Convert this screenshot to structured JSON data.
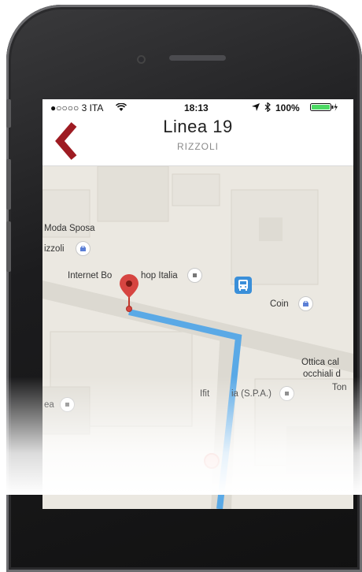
{
  "status_bar": {
    "carrier": "●○○○○ 3 ITA",
    "time": "18:13",
    "battery": "100%"
  },
  "nav": {
    "title": "Linea 19",
    "subtitle": "RIZZOLI"
  },
  "map": {
    "labels": {
      "moda_sposa": "Moda Sposa",
      "rizzoli": "izzoli",
      "internet_shop": "Internet Bo",
      "internet_shop_tail": "hop Italia",
      "coin": "Coin",
      "ottica_line1": "Ottica cal",
      "ottica_line2": "occhiali d",
      "ottica_line3": "Ton",
      "ifitalia": "Ifit",
      "ifitalia_tail": "ia (S.P.A.)",
      "area": "ea"
    },
    "route_color": "#5aa9e6",
    "pin_color": "#d64541"
  },
  "colors": {
    "accent": "#9e1b22",
    "map_bg": "#ebe8e1",
    "road": "#dcd9d1"
  }
}
